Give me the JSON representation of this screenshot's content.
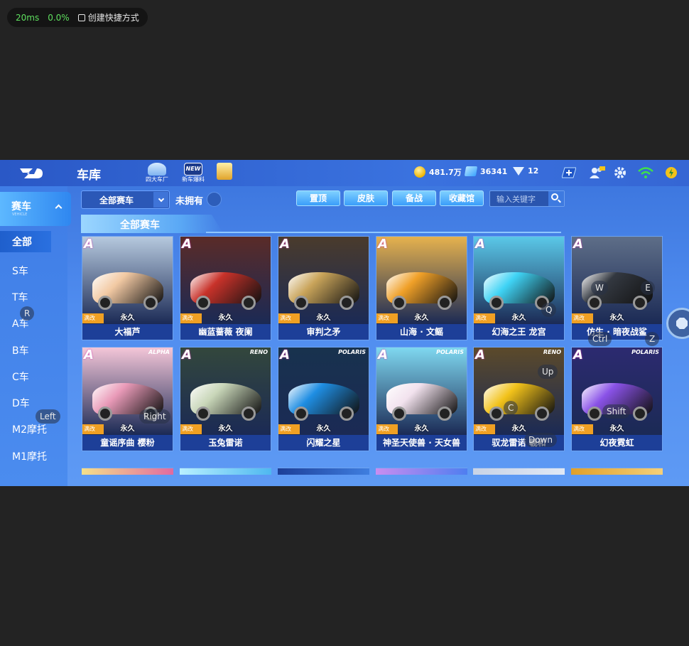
{
  "overlay": {
    "latency": "20ms",
    "loss": "0.0%",
    "shortcut_label": "创建快捷方式"
  },
  "header": {
    "title": "车库",
    "nav": [
      {
        "label": "四大车厂",
        "icon": "garage-icon"
      },
      {
        "label": "新车爆料",
        "badge": "NEW",
        "icon": "new-car-icon"
      },
      {
        "label": "",
        "icon": "gift-icon"
      }
    ],
    "coins": "481.7万",
    "tickets": "36341",
    "gems": "12"
  },
  "sidebar": {
    "header_label": "赛车",
    "header_sub": "VEHICLE",
    "items": [
      "全部",
      "S车",
      "T车",
      "A车",
      "B车",
      "C车",
      "D车",
      "M2摩托",
      "M1摩托"
    ]
  },
  "filter": {
    "selected": "全部赛车",
    "owned_label": "未拥有"
  },
  "toolbar": {
    "buttons": [
      "置顶",
      "皮肤",
      "备战",
      "收藏馆"
    ],
    "search_placeholder": "输入关键字"
  },
  "section_title": "全部赛车",
  "cards": [
    {
      "name": "大福芦",
      "grade": "A",
      "mod": "满改",
      "duration": "永久",
      "color": "#f2c9a3",
      "bg": "#b6c9de"
    },
    {
      "name": "幽蓝蔷薇 夜阑",
      "grade": "A",
      "mod": "满改",
      "duration": "永久",
      "color": "#c8322a",
      "bg": "#5a2b28"
    },
    {
      "name": "审判之矛",
      "grade": "A",
      "mod": "满改",
      "duration": "永久",
      "color": "#c9a45a",
      "bg": "#4a3b2c"
    },
    {
      "name": "山海 · 文鳐",
      "grade": "A",
      "mod": "满改",
      "duration": "永久",
      "color": "#f0a028",
      "bg": "#e6b24e"
    },
    {
      "name": "幻海之王 龙宫",
      "grade": "A",
      "mod": "满改",
      "duration": "永久",
      "color": "#3fd3f5",
      "bg": "#5ac8e8"
    },
    {
      "name": "仿生 · 暗夜战鲨",
      "grade": "A",
      "mod": "满改",
      "duration": "永久",
      "color": "#333840",
      "bg": "#5e6e88"
    },
    {
      "name": "童谣序曲 樱粉",
      "grade": "A",
      "mod": "满改",
      "duration": "永久",
      "color": "#e99ab8",
      "bg": "#f4c6d8"
    },
    {
      "name": "玉兔雷诺",
      "grade": "A",
      "mod": "满改",
      "duration": "永久",
      "color": "#c8d6b8",
      "bg": "#33473c"
    },
    {
      "name": "闪耀之星",
      "grade": "A",
      "mod": "满改",
      "duration": "永久",
      "color": "#1f8ee3",
      "bg": "#18324e"
    },
    {
      "name": "神圣天使兽 · 天女兽",
      "grade": "A",
      "mod": "满改",
      "duration": "永久",
      "color": "#f2e2ee",
      "bg": "#7fd8f0"
    },
    {
      "name": "驭龙雷诺 羲和",
      "grade": "A",
      "mod": "满改",
      "duration": "永久",
      "color": "#f2c21a",
      "bg": "#5c4a2a"
    },
    {
      "name": "幻夜霓虹",
      "grade": "A",
      "mod": "满改",
      "duration": "永久",
      "color": "#8a52e8",
      "bg": "#2c2a70"
    }
  ],
  "card_logos": [
    "",
    "",
    "",
    "",
    "",
    "",
    "ALPHA",
    "RENO",
    "POLARIS",
    "POLARIS",
    "RENO",
    "POLARIS"
  ],
  "keymap": {
    "R": "R",
    "W": "W",
    "E": "E",
    "Q": "Q",
    "Ctrl": "Ctrl",
    "Z": "Z",
    "Up": "Up",
    "Left": "Left",
    "Right": "Right",
    "C": "C",
    "Down": "Down",
    "Shift": "Shift"
  }
}
